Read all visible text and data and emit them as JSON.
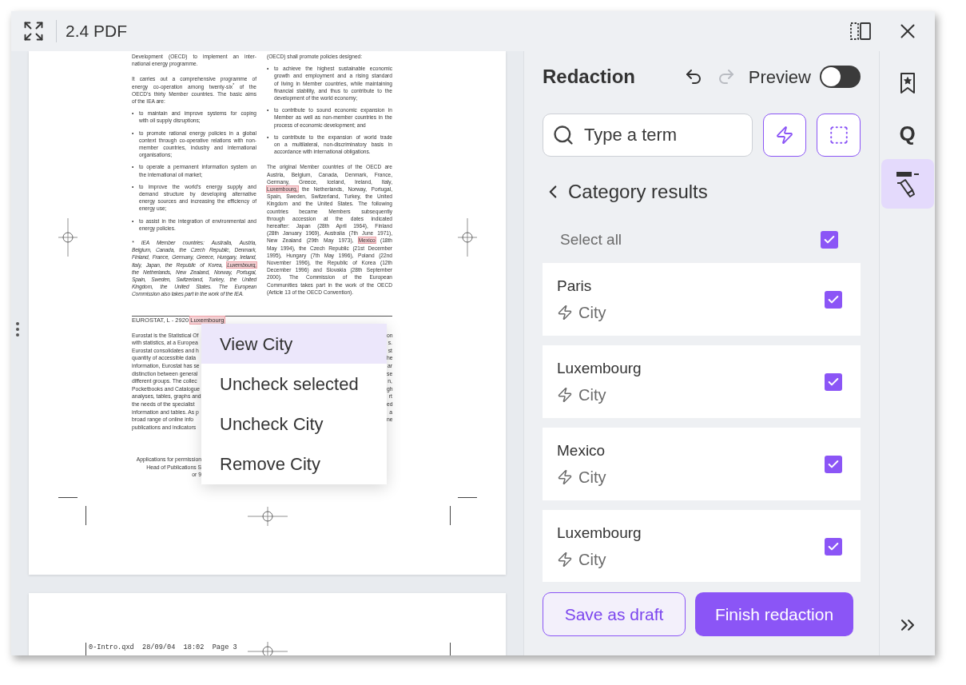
{
  "window": {
    "title": "2.4 PDF"
  },
  "page_1": {
    "left_column": [
      {
        "kind": "para",
        "lines": [
          "Development (OECD) to implement an inter-",
          "national energy programme."
        ]
      },
      {
        "kind": "para",
        "lines": [
          "It carries out a comprehensive programme of",
          "energy co-operation among twenty-six$^{*}$ of the",
          "OECD’s thirty Member countries. The basic aims",
          "of the IEA are:"
        ]
      },
      {
        "kind": "bullet",
        "marker": "•",
        "lines": [
          "to maintain and improve systems for coping",
          "with oil supply disruptions;"
        ]
      },
      {
        "kind": "bullet",
        "marker": "•",
        "lines": [
          "to promote rational energy policies in a global",
          "context through co-operative relations with non-",
          "member countries, industry and international",
          "organisations;"
        ]
      },
      {
        "kind": "bullet",
        "marker": "•",
        "lines": [
          "to operate a permanent information system on",
          "the international oil market;"
        ]
      },
      {
        "kind": "bullet",
        "marker": "•",
        "lines": [
          "to improve the world’s energy supply and",
          "demand structure by developing alternative",
          "energy sources and increasing the efficiency of",
          "energy use;"
        ]
      },
      {
        "kind": "bullet",
        "marker": "•",
        "lines": [
          "to assist in the integration of environmental and",
          "energy policies."
        ]
      },
      {
        "kind": "footnote",
        "lines": [
          "* IEA Member countries: Australia, Austria,",
          "Belgium, Canada, the Czech Republic, Denmark,",
          "Finland, France, Germany, Greece, Hungary, Ireland,",
          {
            "parts": [
              {
                "text": "Italy, Japan, the Republic of Korea, ",
                "highlighted": false
              },
              {
                "text": "Luxembourg,",
                "highlighted": true
              }
            ]
          },
          "the Netherlands, New Zealand, Norway, Portugal,",
          "Spain, Sweden, Switzerland, Turkey, the United",
          "Kingdom, the United States. The European",
          "Commission also takes part in the work of the IEA."
        ]
      }
    ],
    "right_column": [
      {
        "kind": "para",
        "lines": [
          "(OECD) shall promote policies designed:"
        ]
      },
      {
        "kind": "bullet",
        "marker": "•",
        "lines": [
          "to achieve the highest sustainable economic",
          "growth and employment and a rising standard",
          "of living in Member countries, while maintaining",
          "financial stability, and thus to contribute to the",
          "development of the world economy;"
        ]
      },
      {
        "kind": "bullet",
        "marker": "•",
        "lines": [
          "to contribute to sound economic expansion in",
          "Member as well as non-member countries in the",
          "process of economic development; and"
        ]
      },
      {
        "kind": "bullet",
        "marker": "•",
        "lines": [
          "to contribute to the expansion of world trade",
          "on a multilateral, non-discriminatory basis in",
          "accordance with international obligations."
        ]
      },
      {
        "kind": "para",
        "lines": [
          "The original Member countries of the OECD are",
          "Austria, Belgium, Canada, Denmark, France,",
          "Germany, Greece, Iceland, Ireland, Italy,",
          {
            "parts": [
              {
                "text": "Luxembourg,",
                "highlighted": true
              },
              {
                "text": " the Netherlands, Norway, Portugal,",
                "highlighted": false
              }
            ]
          },
          "Spain, Sweden, Switzerland, Turkey, the United",
          "Kingdom and the United States. The following",
          "countries became Members subsequently",
          "through accession at the dates indicated",
          "hereafter: Japan (28th April 1964), Finland",
          "(28th January 1969), Australia (7th June 1971),",
          {
            "parts": [
              {
                "text": "New Zealand (29th May 1973), ",
                "highlighted": false
              },
              {
                "text": "Mexico",
                "highlighted": true
              },
              {
                "text": " (18th",
                "highlighted": false
              }
            ]
          },
          "May 1994), the Czech Republic (21st December",
          "1995), Hungary (7th May 1996), Poland (22nd",
          "November 1996), the Republic of Korea (12th",
          "December 1996) and Slovakia (28th September",
          "2000). The Commission of the European",
          "Communities takes part in the work of the OECD",
          "(Article 13 of the OECD Convention)."
        ]
      }
    ],
    "section_heading": [
      {
        "text": "EUROSTAT, L - 2920 ",
        "highlighted": false
      },
      {
        "text": "Luxembourg",
        "highlighted": true
      }
    ],
    "fragment_lines": [
      {
        "left": "Eurostat is the Statistical Of",
        "right": "on"
      },
      {
        "left": "with statistics, at a Europea",
        "right": "s."
      },
      {
        "left": "Eurostat consolidates and h",
        "right": "st"
      },
      {
        "left": "quantity of accessible data",
        "right": "he"
      },
      {
        "left": "information, Eurostat has se",
        "right": "ar"
      },
      {
        "left": "distinction between general",
        "right": "se"
      },
      {
        "left": "different groups. The collec",
        "right": "n,"
      },
      {
        "left": "Pocketbooks and Catalogue",
        "right": "gh"
      },
      {
        "left": "analyses, tables, graphs and",
        "right": "rt"
      },
      {
        "left": "the needs of the specialist",
        "right": "ed"
      },
      {
        "left": "information and tables. As p",
        "right": "a"
      },
      {
        "left": "broad range of online info",
        "right": "ne"
      },
      {
        "left": "publications and indicators"
      }
    ],
    "note_lines": [
      "Applications for permission",
      "Head of Publications S",
      "or 9"
    ]
  },
  "page_2": {
    "slug": "0-Intro.qxd  28/09/04  18:02  Page 3"
  },
  "context_menu": {
    "items": [
      {
        "label": "View City",
        "selected": true
      },
      {
        "label": "Uncheck selected",
        "selected": false
      },
      {
        "label": "Uncheck City",
        "selected": false
      },
      {
        "label": "Remove City",
        "selected": false
      }
    ]
  },
  "panel": {
    "title": "Redaction",
    "undo": {
      "disabled": false
    },
    "redo": {
      "disabled": true
    },
    "preview": {
      "label": "Preview",
      "on": false
    },
    "search": {
      "placeholder": "Type a term"
    },
    "results_heading": "Category results",
    "select_all": {
      "label": "Select all",
      "checked": true
    },
    "results": [
      {
        "name": "Paris",
        "category": "City",
        "checked": true
      },
      {
        "name": "Luxembourg",
        "category": "City",
        "checked": true
      },
      {
        "name": "Mexico",
        "category": "City",
        "checked": true
      },
      {
        "name": "Luxembourg",
        "category": "City",
        "checked": true
      }
    ],
    "buttons": [
      {
        "label": "Save as draft",
        "kind": "outline"
      },
      {
        "label": "Finish redaction",
        "kind": "primary"
      }
    ]
  },
  "rail": {
    "items": [
      {
        "kind": "bookmark",
        "selected": false
      },
      {
        "kind": "text",
        "label": "Q",
        "selected": false
      },
      {
        "kind": "redact",
        "selected": true
      }
    ]
  }
}
